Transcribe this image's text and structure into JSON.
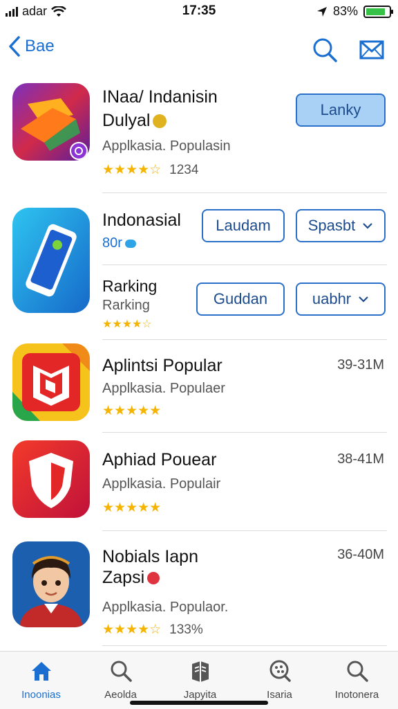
{
  "status_bar": {
    "carrier": "adar",
    "time": "17:35",
    "battery_percent": "83%",
    "battery_level": 0.83
  },
  "nav": {
    "back_label": "Bae"
  },
  "apps": [
    {
      "title": "INaa/ Indanisin",
      "title_line2": "Dulyal",
      "subtitle": "Applkasia. Populasin",
      "rating": 4.5,
      "rating_text": "★★★★☆",
      "count": "1234",
      "button": "Lanky"
    },
    {
      "title": "Indonasial",
      "subtitle": "80r",
      "sub_title2": "Rarking",
      "sub_sub2": "Rarking",
      "rating": 4.5,
      "rating_text": "★★★★☆",
      "button1": "Laudam",
      "button2": "Spasbt",
      "button3": "Guddan",
      "button4": "uabhr"
    },
    {
      "title": "Aplintsi Popular",
      "subtitle": "Applkasia. Populaer",
      "rating_text": "★★★★★",
      "size": "39-31M"
    },
    {
      "title": "Aphiad Pouear",
      "subtitle": "Applkasia. Populair",
      "rating_text": "★★★★★",
      "size": "38-41M"
    },
    {
      "title": "Nobials Iapn",
      "title_line2": "Zapsi",
      "subtitle": "Applkasia. Populaor.",
      "rating_text": "★★★★☆",
      "count": "133%",
      "size": "36-40M"
    }
  ],
  "tabs": [
    {
      "label": "Inoonias",
      "icon": "home-icon"
    },
    {
      "label": "Aeolda",
      "icon": "search-icon"
    },
    {
      "label": "Japyita",
      "icon": "book-icon"
    },
    {
      "label": "Isaria",
      "icon": "scan-icon"
    },
    {
      "label": "Inotonera",
      "icon": "search-icon"
    }
  ],
  "colors": {
    "accent": "#1a6fd1",
    "star": "#f5b400",
    "battery": "#35c247"
  }
}
